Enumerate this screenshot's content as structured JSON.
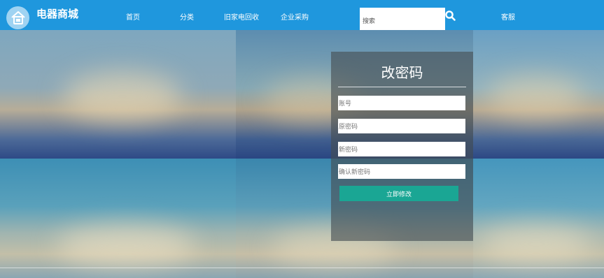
{
  "header": {
    "site_name": "电器商城",
    "nav": [
      "首页",
      "分类",
      "旧家电回收",
      "企业采购"
    ],
    "search_placeholder": "搜索",
    "service_label": "客服",
    "icons": {
      "logo": "home-appliance-logo-icon",
      "search": "magnifier-search-icon"
    }
  },
  "form": {
    "title": "改密码",
    "fields": {
      "account_placeholder": "账号",
      "old_password_placeholder": "原密码",
      "new_password_placeholder": "新密码",
      "confirm_password_placeholder": "确认新密码"
    },
    "submit_label": "立即修改"
  },
  "colors": {
    "header_bg": "#1f97dd",
    "button_bg": "#1aa694",
    "panel_bg": "rgba(70,78,82,0.62)"
  }
}
